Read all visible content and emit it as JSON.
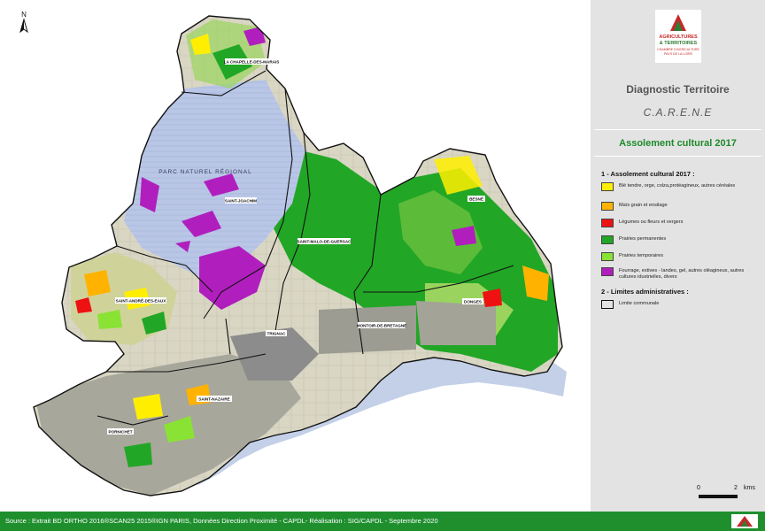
{
  "map": {
    "north_arrow_label": "N",
    "park_label": "PARC NATUREL RÉGIONAL",
    "places": {
      "chapelle": "LA CHAPELLE-DES-MARAIS",
      "saint_joachim": "SAINT-JOACHIM",
      "saint_malo": "SAINT-MALO-DE-GUERSAC",
      "besne": "BESNÉ",
      "saint_andre": "SAINT-ANDRÉ-DES-EAUX",
      "trignac": "TRIGNAC",
      "montoir": "MONTOIR-DE-BRETAGNE",
      "donges": "DONGES",
      "saint_nazaire": "SAINT-NAZAIRE",
      "pornichet": "PORNICHET"
    },
    "colors": {
      "park": "#b9c6e6",
      "sea": "#bccbe6",
      "background": "#dcd9c8",
      "urban": "#8c8c8c",
      "boundary": "#111111"
    }
  },
  "sidebar": {
    "logo_line1": "AGRICULTURES",
    "logo_line2": "& TERRITOIRES",
    "logo_line3": "CHAMBRE D'AGRICULTURE",
    "logo_line4": "PAYS DE LA LOIRE",
    "title": "Diagnostic Territoire",
    "subtitle": "C.A.R.E.N.E",
    "map_title": "Assolement cultural 2017",
    "section1": "1 - Assolement cultural 2017 :",
    "legend": [
      {
        "label": "Blé tendre, orge, colza,protéagineux, autres céréales",
        "color": "#ffee00"
      },
      {
        "label": "Maïs grain et ensilage",
        "color": "#ffb300"
      },
      {
        "label": "Légumes ou fleurs et vergers",
        "color": "#ee1111"
      },
      {
        "label": "Prairies permanentes",
        "color": "#22a626"
      },
      {
        "label": "Prairies temporaires",
        "color": "#8ae234"
      },
      {
        "label": "Fourrage, estives - landes, gel, autres oléagineux, autres cultures idustrielles, divers",
        "color": "#b01fbd"
      }
    ],
    "section2": "2 - Limites administratives :",
    "limit_label": "Limite communale",
    "scale_zero": "0",
    "scale_two": "2",
    "scale_unit": "kms"
  },
  "footer": {
    "source": "Source :  Extrait BD ORTHO 2016®SCAN25 2015®IGN PARIS, Données Direction Proximité - CAPDL- Réalisation : SIG/CAPDL - Septembre 2020"
  }
}
